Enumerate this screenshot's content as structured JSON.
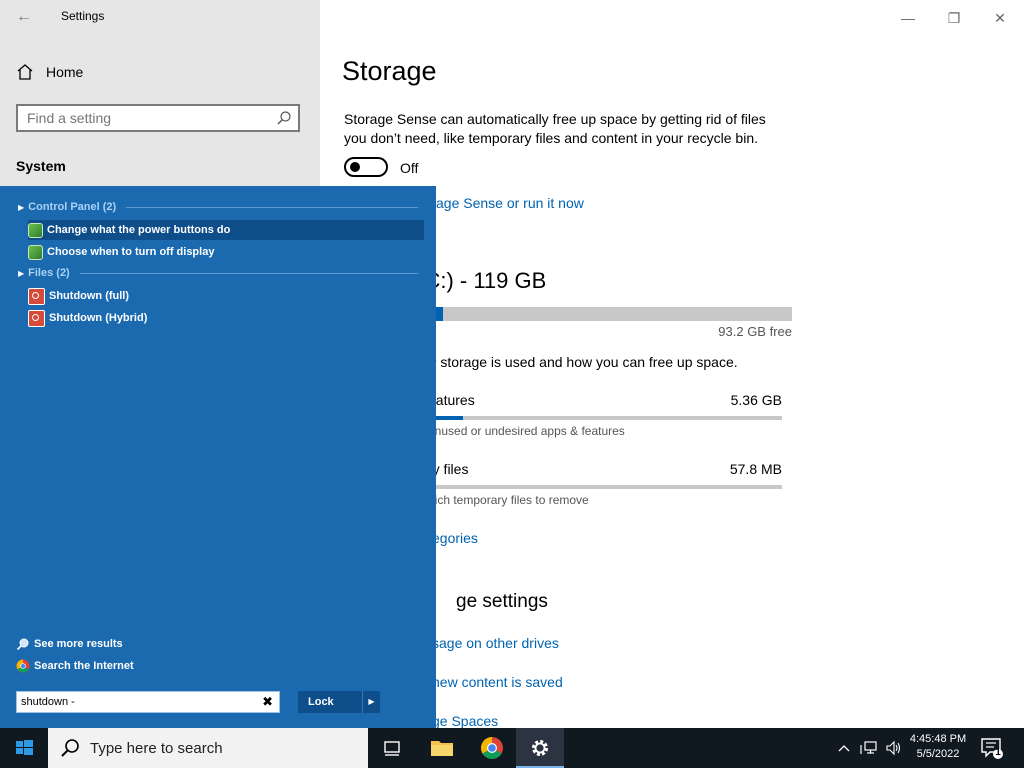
{
  "window": {
    "title": "Settings",
    "controls": {
      "minimize": "—",
      "maximize": "❐",
      "close": "✕"
    }
  },
  "sidebar": {
    "home_label": "Home",
    "search_placeholder": "Find a setting",
    "section_title": "System"
  },
  "storage": {
    "page_title": "Storage",
    "description": "Storage Sense can automatically free up space by getting rid of files you don’t need, like temporary files and content in your recycle bin.",
    "toggle_state": "Off",
    "configure_link": "age Sense or run it now",
    "drive_title": "k (C:) - 119 GB",
    "drive_used_fraction": 0.22,
    "free_text": "93.2 GB free",
    "usage_desc": "ur storage is used and how you can free up space.",
    "categories": [
      {
        "name": "eatures",
        "size": "5.36 GB",
        "sub": "unused or undesired apps & features",
        "fraction": 0.1
      },
      {
        "name": "ry files",
        "size": "57.8 MB",
        "sub": "hich temporary files to remove",
        "fraction": 0.0
      }
    ],
    "show_more_link": "egories",
    "more_settings_title": "ge settings",
    "links": {
      "other_drives": "sage on other drives",
      "new_content": "new content is saved",
      "spaces": "ge Spaces"
    }
  },
  "start_search": {
    "groups": [
      {
        "label": "Control Panel (2)"
      },
      {
        "label": "Files (2)"
      }
    ],
    "results": [
      {
        "label": "Change what the power buttons do",
        "icon": "control-panel-icon"
      },
      {
        "label": "Choose when to turn off display",
        "icon": "control-panel-icon"
      },
      {
        "label": "Shutdown (full)",
        "icon": "power-icon"
      },
      {
        "label": "Shutdown (Hybrid)",
        "icon": "power-icon"
      }
    ],
    "see_more": "See more results",
    "search_internet": "Search the Internet",
    "query": "shutdown -",
    "lock_label": "Lock"
  },
  "taskbar": {
    "search_placeholder": "Type here to search",
    "time": "4:45:48 PM",
    "date": "5/5/2022",
    "notification_count": "1"
  },
  "colors": {
    "accent": "#0063b1",
    "start_panel": "#1b6ab0",
    "taskbar": "#101820",
    "sidebar_bg": "#e6e6e6"
  }
}
